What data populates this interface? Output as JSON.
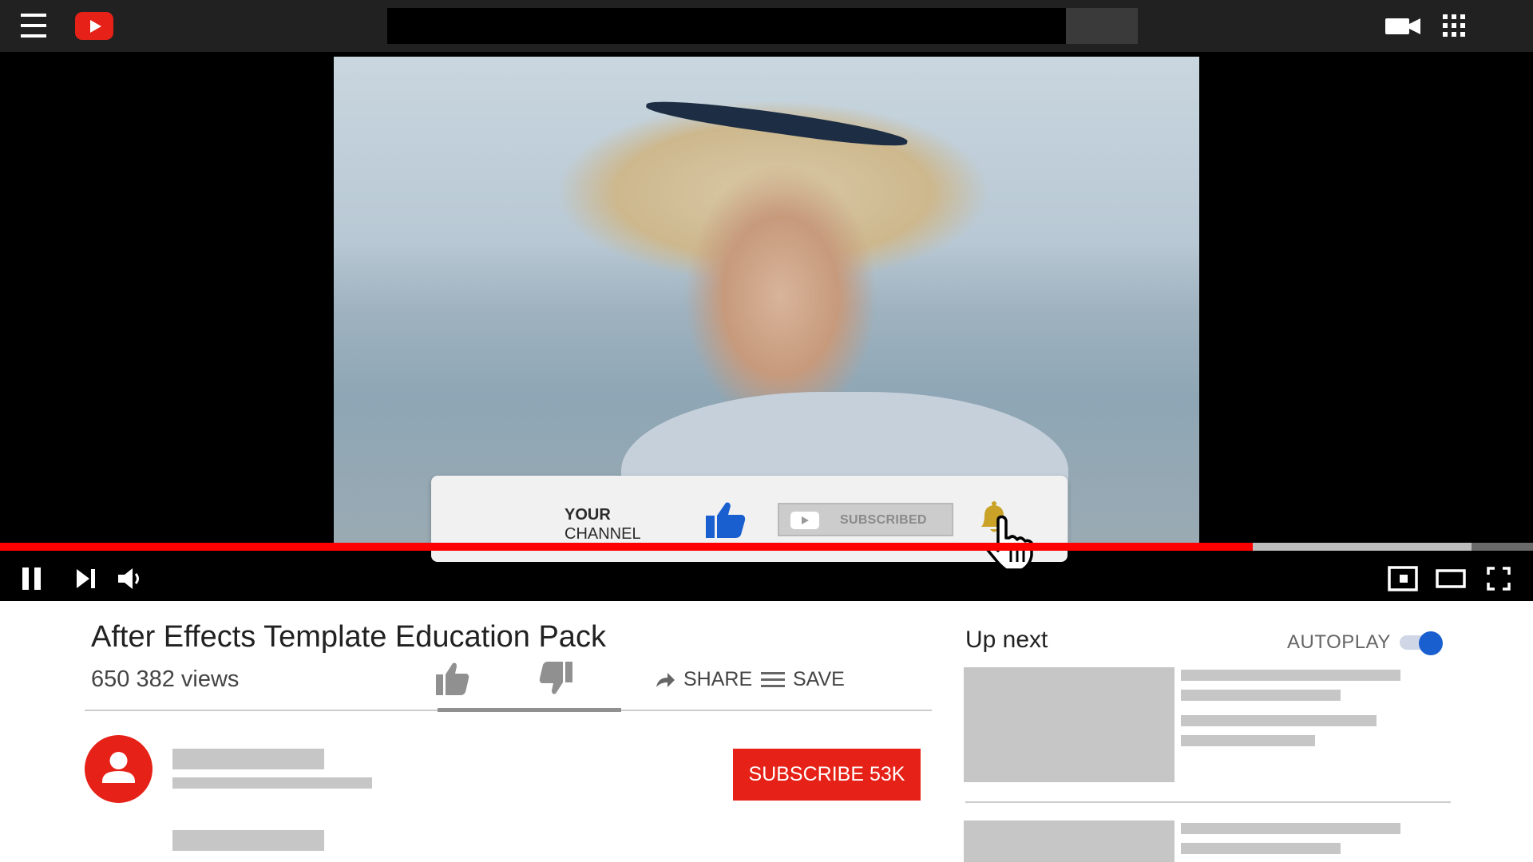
{
  "header": {
    "menu_icon": "hamburger-menu-icon",
    "logo_icon": "youtube-play-logo-icon",
    "search": {
      "value": "",
      "placeholder": ""
    },
    "icons": [
      "video-camera-icon",
      "apps-grid-icon"
    ]
  },
  "overlay": {
    "line1": "YOUR",
    "line2": "CHANNEL",
    "subscribe_label": "SUBSCRIBED",
    "icons": [
      "thumbs-up-icon",
      "notification-bell-icon",
      "hand-cursor-icon"
    ]
  },
  "player": {
    "progress_played": 0.817,
    "progress_buffered": 0.96,
    "controls": [
      "pause-icon",
      "next-icon",
      "volume-icon",
      "miniplayer-icon",
      "theater-mode-icon",
      "fullscreen-icon"
    ]
  },
  "video": {
    "title": "After Effects Template Education Pack",
    "views": "650 382 views",
    "share_label": "SHARE",
    "save_label": "SAVE",
    "subscribe_label": "SUBSCRIBE 53K"
  },
  "sidebar": {
    "title": "Up next",
    "autoplay_label": "AUTOPLAY",
    "autoplay_on": true
  },
  "colors": {
    "brand_red": "#e62117",
    "progress_red": "#ff0000",
    "like_blue": "#1a5fd0",
    "bell_gold": "#c9a227",
    "toggle_blue": "#1a5fd0"
  }
}
